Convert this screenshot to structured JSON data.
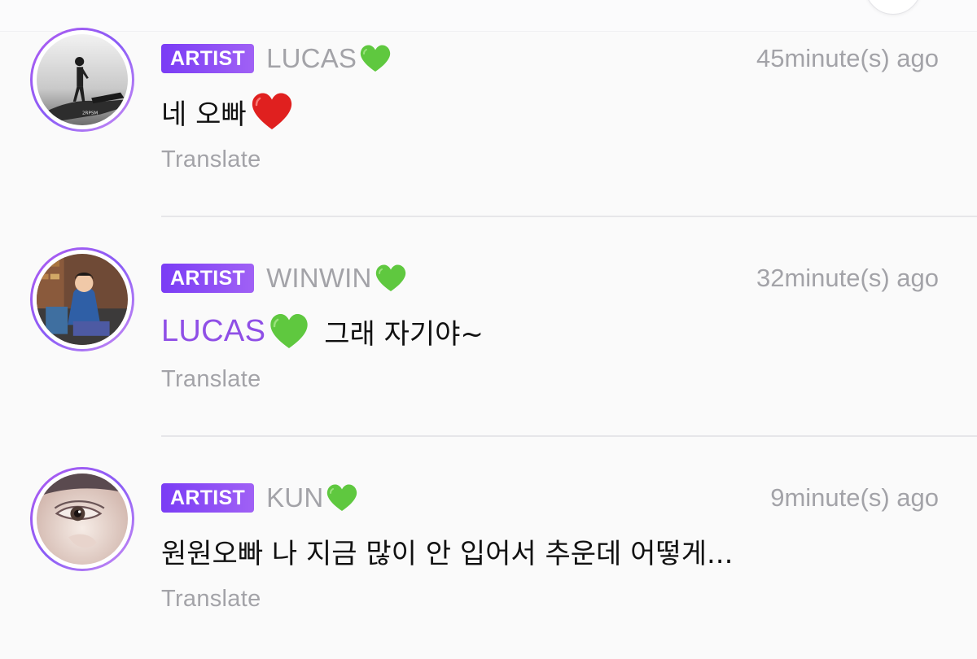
{
  "comments": [
    {
      "badge": "ARTIST",
      "username": "LUCAS",
      "username_icon": "green-heart-icon",
      "timestamp": "45minute(s) ago",
      "message": "네 오빠",
      "message_icon": "red-heart-icon",
      "translate_label": "Translate",
      "avatar": "person-standing-on-car-photo"
    },
    {
      "badge": "ARTIST",
      "username": "WINWIN",
      "username_icon": "green-heart-icon",
      "timestamp": "32minute(s) ago",
      "mention": "LUCAS",
      "mention_icon": "green-heart-icon",
      "message": "그래 자기야~",
      "translate_label": "Translate",
      "avatar": "person-in-blue-suit-photo"
    },
    {
      "badge": "ARTIST",
      "username": "KUN",
      "username_icon": "green-heart-icon",
      "timestamp": "9minute(s) ago",
      "message": "원원오빠 나 지금 많이 안 입어서 추운데 어떻게...",
      "translate_label": "Translate",
      "avatar": "eye-closeup-photo"
    }
  ],
  "colors": {
    "badge_gradient_start": "#7a3cf5",
    "badge_gradient_end": "#a061f5",
    "mention": "#8f4fe6",
    "muted_text": "#a3a3a8",
    "heart_green": "#5fc83f",
    "heart_red": "#e0201f",
    "avatar_ring": "#a95cf3"
  }
}
